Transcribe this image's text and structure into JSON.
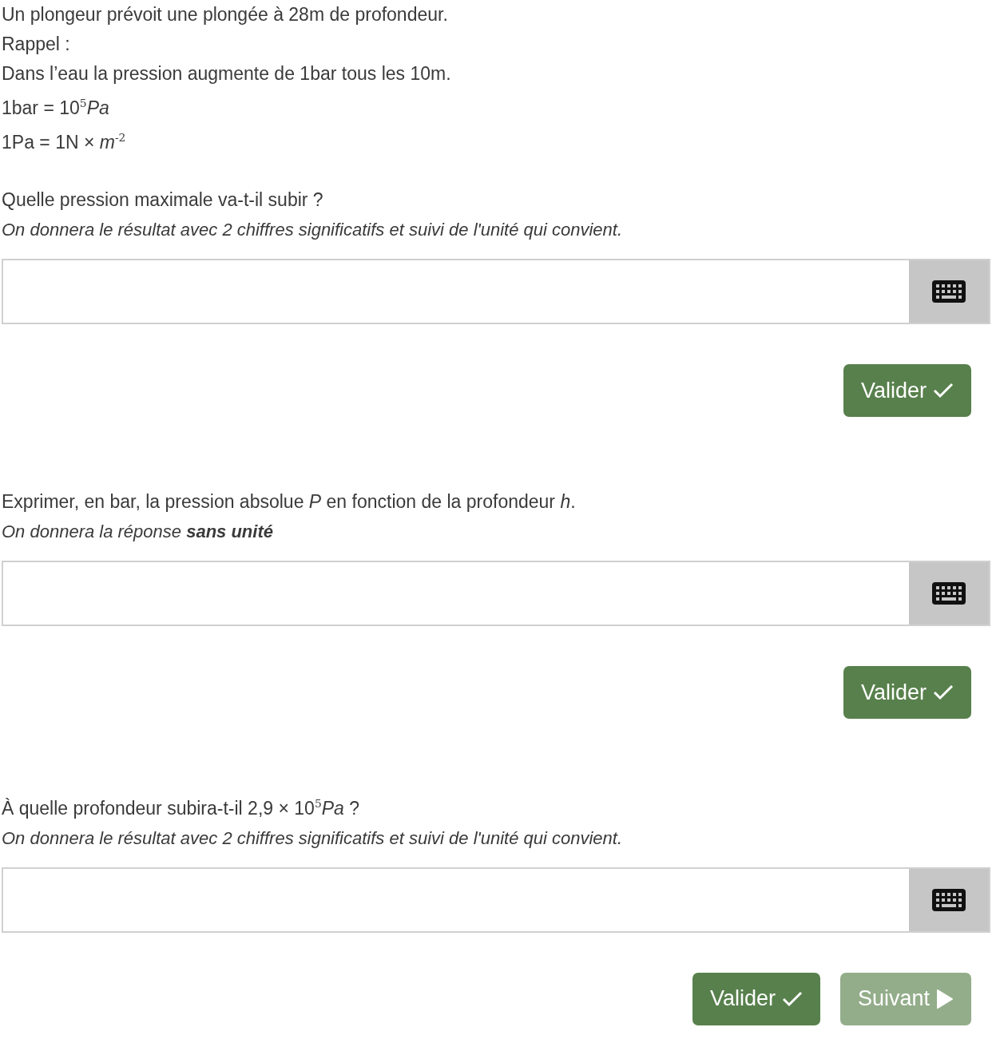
{
  "intro": [
    "Un plongeur prévoit une plongée à 28m de profondeur.",
    "Rappel :",
    "Dans l’eau la pression augmente de 1bar tous les 10m.",
    "1bar = 10$^{5}$*Pa*",
    "1Pa = 1N × *m*$^{-2}$"
  ],
  "questions": [
    {
      "prompt": "Quelle pression maximale va-t-il subir ?",
      "instruction": "On donnera le résultat avec 2 chiffres significatifs et suivi de l'unité qui convient.",
      "buttons": [
        {
          "kind": "validate",
          "label": "Valider",
          "disabled": false
        }
      ]
    },
    {
      "prompt": "Exprimer, en bar, la pression absolue *P* en fonction de la profondeur *h*.",
      "instruction": "On donnera la réponse **sans unité**",
      "buttons": [
        {
          "kind": "validate",
          "label": "Valider",
          "disabled": false
        }
      ]
    },
    {
      "prompt": "À quelle profondeur subira-t-il 2,9 × 10$^{5}$*Pa* ?",
      "instruction": "On donnera le résultat avec 2 chiffres significatifs et suivi de l'unité qui convient.",
      "buttons": [
        {
          "kind": "validate",
          "label": "Valider",
          "disabled": false
        },
        {
          "kind": "next",
          "label": "Suivant",
          "disabled": true
        }
      ]
    }
  ]
}
